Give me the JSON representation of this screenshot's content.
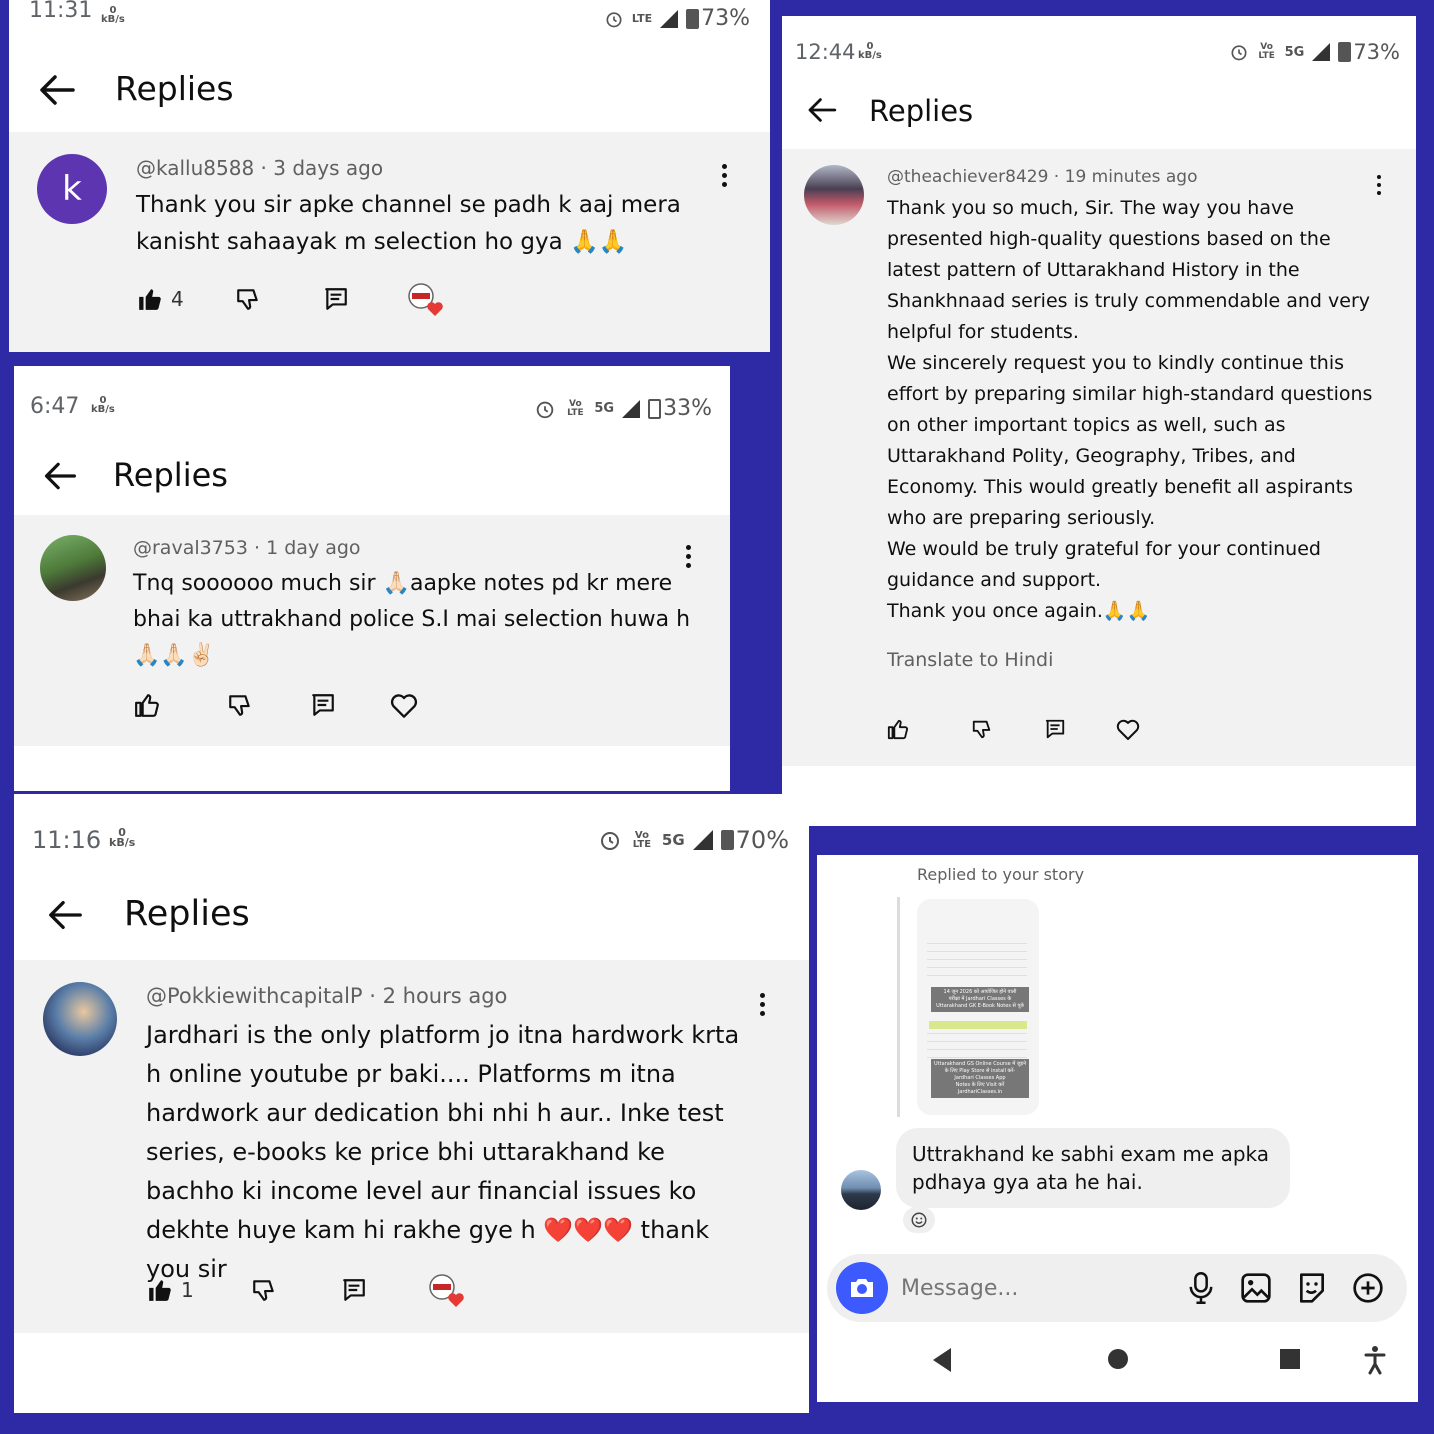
{
  "panel1": {
    "status": {
      "time": "11:31",
      "kbs": "0",
      "kbs_unit": "kB/s",
      "network": "LTE",
      "battery": "73%"
    },
    "header": {
      "title": "Replies"
    },
    "comment": {
      "avatar_letter": "k",
      "author": "@kallu8588",
      "time": "3 days ago",
      "text": "Thank you sir apke channel se padh k aaj mera kanisht sahaayak m selection ho gya 🙏🙏",
      "likes": "4"
    }
  },
  "panel2": {
    "status": {
      "time": "6:47",
      "kbs": "0",
      "kbs_unit": "kB/s",
      "volte": "Vo LTE",
      "network": "5G",
      "battery": "33%"
    },
    "header": {
      "title": "Replies"
    },
    "comment": {
      "author": "@raval3753",
      "time": "1 day ago",
      "text": "Tnq soooooo much sir 🙏🏻aapke notes pd kr mere bhai ka  uttrakhand police S.I mai selection huwa h 🙏🏻🙏🏻✌🏻"
    }
  },
  "panel3": {
    "status": {
      "time": "12:44",
      "kbs": "0",
      "kbs_unit": "kB/s",
      "volte": "Vo LTE",
      "network": "5G",
      "battery": "73%"
    },
    "header": {
      "title": "Replies"
    },
    "comment": {
      "author": "@theachiever8429",
      "time": "19 minutes ago",
      "paragraphs": [
        "Thank you so much, Sir. The way you have presented high-quality questions based on the latest pattern of Uttarakhand History in the Shankhnaad series is truly commendable and very helpful for students.",
        "We sincerely request you to kindly continue this effort by preparing similar high-standard questions on other important topics as well, such as Uttarakhand Polity, Geography, Tribes, and Economy. This would greatly benefit all aspirants who are preparing seriously.",
        "We would be truly grateful for your continued guidance and support.",
        "Thank you once again.🙏🙏"
      ],
      "translate": "Translate to Hindi"
    }
  },
  "panel4": {
    "status": {
      "time": "11:16",
      "kbs": "0",
      "kbs_unit": "kB/s",
      "volte": "Vo LTE",
      "network": "5G",
      "battery": "70%"
    },
    "header": {
      "title": "Replies"
    },
    "comment": {
      "author": "@PokkiewithcapitalP",
      "time": "2 hours ago",
      "text": "Jardhari is the only platform jo itna hardwork krta h online youtube pr baki.... Platforms m itna hardwork aur dedication bhi nhi h aur.. Inke test series, e-books ke price bhi uttarakhand ke bachho ki income level aur financial issues ko dekhte huye kam hi rakhe gye h ❤️❤️❤️ thank you sir",
      "likes": "1"
    }
  },
  "panel5": {
    "replied_label": "Replied to your story",
    "story_lines": [
      "14 जून 2026 को आयोजित होने वाली",
      "परीक्षा में Jardhari Classes के",
      "Uttarakhand GK E-Book Notes से पूछे",
      "Uttarakhand GS Online Course में जुड़ने",
      "के लिए Play Store से install करें-",
      "Jardhari Classes App",
      "Notes के लिए Visit करें",
      "JardhariClasses.in"
    ],
    "message": "Uttrakhand ke sabhi exam me apka pdhaya gya ata he hai.",
    "input_placeholder": "Message..."
  },
  "colors": {
    "background": "#2e2aa5",
    "comment_bg": "#f2f2f2",
    "avatar_purple": "#5e35b1",
    "camera_blue": "#3d5afe"
  }
}
